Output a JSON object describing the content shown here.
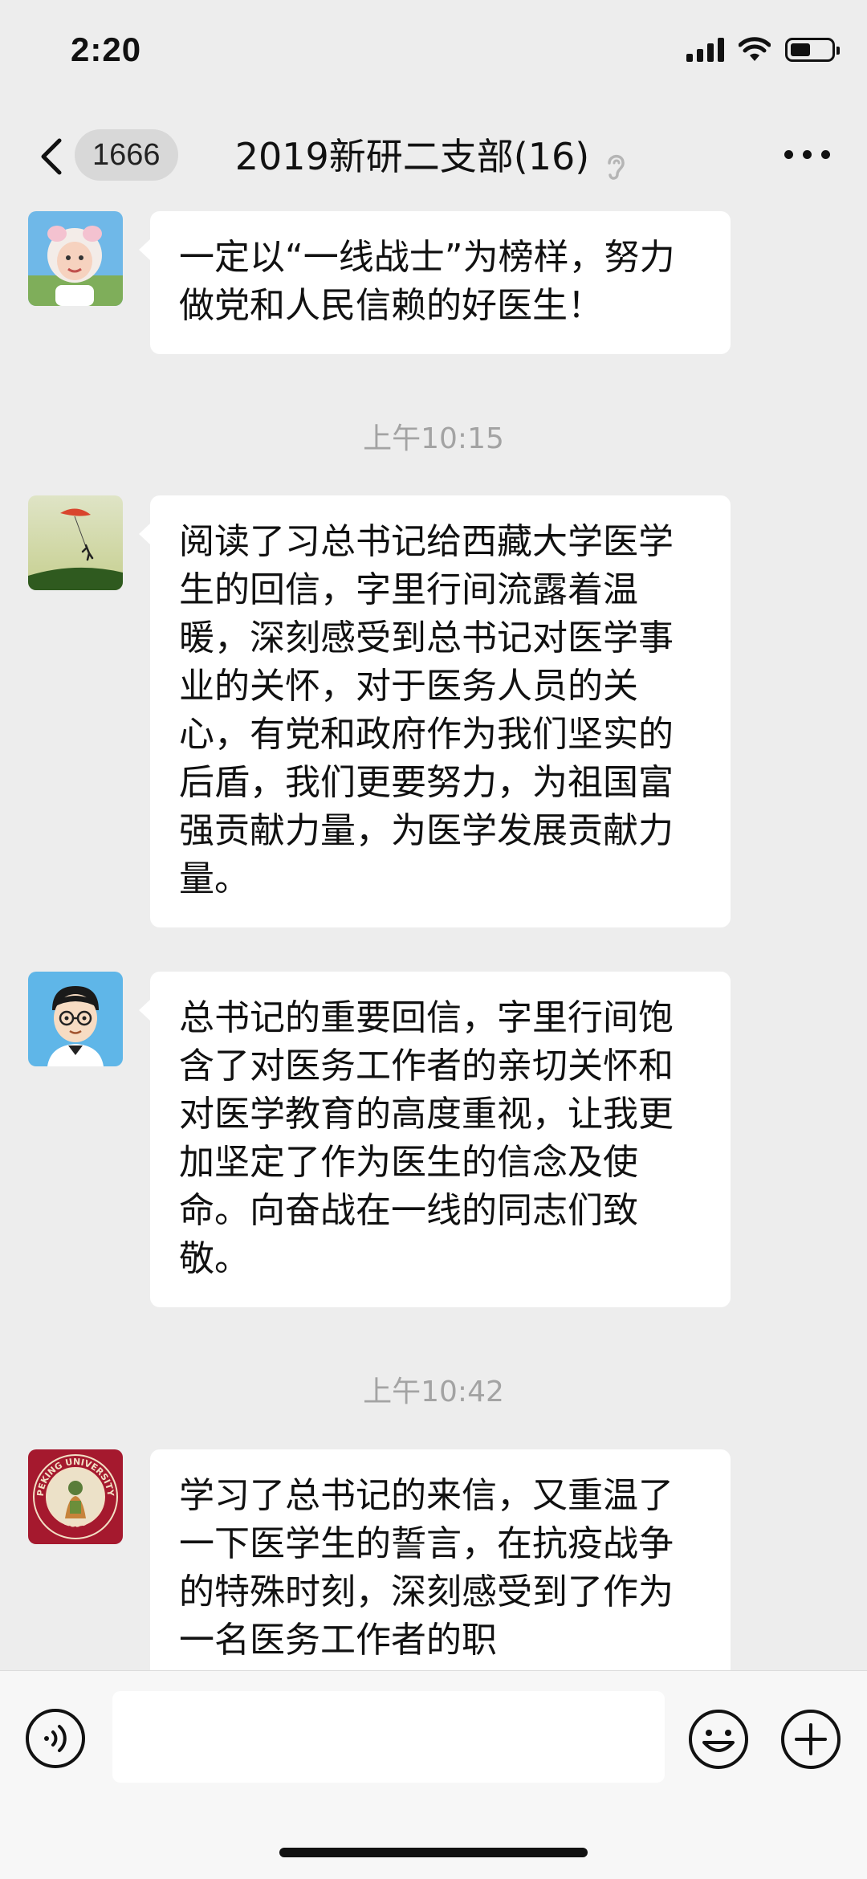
{
  "status_bar": {
    "time": "2:20"
  },
  "header": {
    "unread_count": "1666",
    "title": "2019新研二支部(16)"
  },
  "messages": [
    {
      "type": "text",
      "avatar": "baby-photo-avatar",
      "text": "一定以“一线战士”为榜样，努力做党和人民信赖的好医生！"
    },
    {
      "type": "time",
      "text": "上午10:15"
    },
    {
      "type": "text",
      "avatar": "kite-landscape-avatar",
      "text": "阅读了习总书记给西藏大学医学生的回信，字里行间流露着温暖，深刻感受到总书记对医学事业的关怀，对于医务人员的关心，有党和政府作为我们坚实的后盾，我们更要努力，为祖国富强贡献力量，为医学发展贡献力量。"
    },
    {
      "type": "text",
      "avatar": "cartoon-boy-avatar",
      "text": "总书记的重要回信，字里行间饱含了对医务工作者的亲切关怀和对医学教育的高度重视，让我更加坚定了作为医生的信念及使命。向奋战在一线的同志们致敬。"
    },
    {
      "type": "time",
      "text": "上午10:42"
    },
    {
      "type": "text",
      "avatar": "peking-university-avatar",
      "text": "学习了总书记的来信，又重温了一下医学生的誓言，在抗疫战争的特殊时刻，深刻感受到了作为一名医务工作者的职"
    }
  ],
  "avatar_text": {
    "university": "PEKING UNIVERSITY",
    "year": "1898"
  },
  "input": {
    "value": "",
    "placeholder": ""
  },
  "colors": {
    "background": "#ededed",
    "bubble": "#ffffff",
    "timestamp": "#a3a3a3",
    "badge": "#d8d8d8"
  }
}
